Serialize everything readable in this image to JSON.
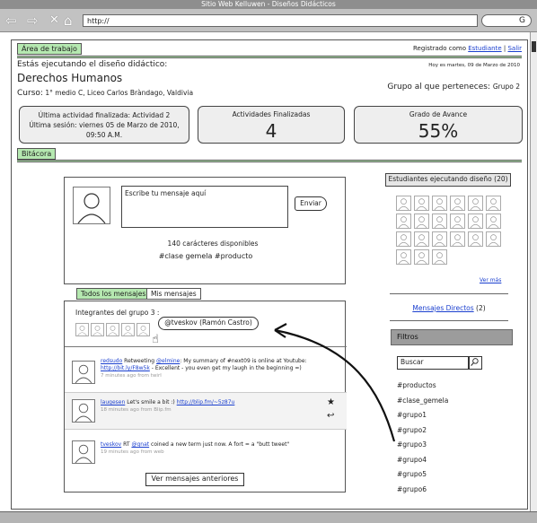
{
  "browser": {
    "title": "Sitio Web Kelluwen - Diseños Didácticos",
    "url": "http://",
    "search_glyph": "G"
  },
  "header": {
    "tab_label": "Área de trabajo",
    "registered_prefix": "Registrado como",
    "user_link": "Estudiante",
    "separator": "|",
    "logout_link": "Salir",
    "date": "Hoy es martes, 09 de Marzo de 2010",
    "running_label": "Estás ejecutando el diseño didáctico:",
    "design_name": "Derechos Humanos",
    "course_label": "Curso:",
    "course_value": "1° medio C, Liceo Carlos Bràndago, Valdivia",
    "group_label": "Grupo al que perteneces:",
    "group_value": "Grupo 2"
  },
  "stats": {
    "last_activity": "Última actividad finalizada: Actividad 2",
    "last_session_1": "Última sesión: viernes 05 de Marzo de 2010,",
    "last_session_2": "09:50 A.M.",
    "finished_label": "Actividades Finalizadas",
    "finished_value": "4",
    "progress_label": "Grado de Avance",
    "progress_value": "55%"
  },
  "bitacora": {
    "tab_label": "Bitácora",
    "composer_placeholder": "Escribe tu mensaje aquí",
    "send_label": "Enviar",
    "chars_available": "140 carácteres disponibles",
    "hashtags": "#clase gemela #producto"
  },
  "messages": {
    "tabs": [
      "Todos los mensajes",
      "Mis mensajes"
    ],
    "members_label": "Integrantes del grupo 3 :",
    "member_tooltip": "@tveskov (Ramón Castro)",
    "items": [
      {
        "user": "redsudo",
        "text_a": "Retweeting",
        "mention": "@elmine",
        "text_b": ": My summary of #next09 is online at Youtube:",
        "link": "http://bit.ly/F8w5k",
        "text_c": "- Excellent - you even get my laugh in the beginning =)",
        "meta": "7 minutes ago from twirl"
      },
      {
        "user": "laugesen",
        "text_a": "Let's smile a bit :)",
        "link": "http://blip.fm/~5z87u",
        "meta": "18 minutes ago from Blip.fm"
      },
      {
        "user": "tveskov",
        "text_a": "RT",
        "mention": "@gnat",
        "text_b": "coined a new term just now. A fort = a \"butt tweet\"",
        "meta": "19 minutes ago from web"
      }
    ],
    "older_button": "Ver mensajes anteriores",
    "star_icon": "★",
    "reply_icon": "↩"
  },
  "sidebar": {
    "students_label": "Estudiantes ejecutando diseño (20)",
    "see_more": "Ver más",
    "direct_messages_link": "Mensajes Directos",
    "direct_messages_count": "(2)",
    "filters_label": "Filtros",
    "search_placeholder": "Buscar",
    "tags": [
      "#productos",
      "#clase_gemela",
      "#grupo1",
      "#grupo2",
      "#grupo3",
      "#grupo4",
      "#grupo5",
      "#grupo6"
    ]
  }
}
